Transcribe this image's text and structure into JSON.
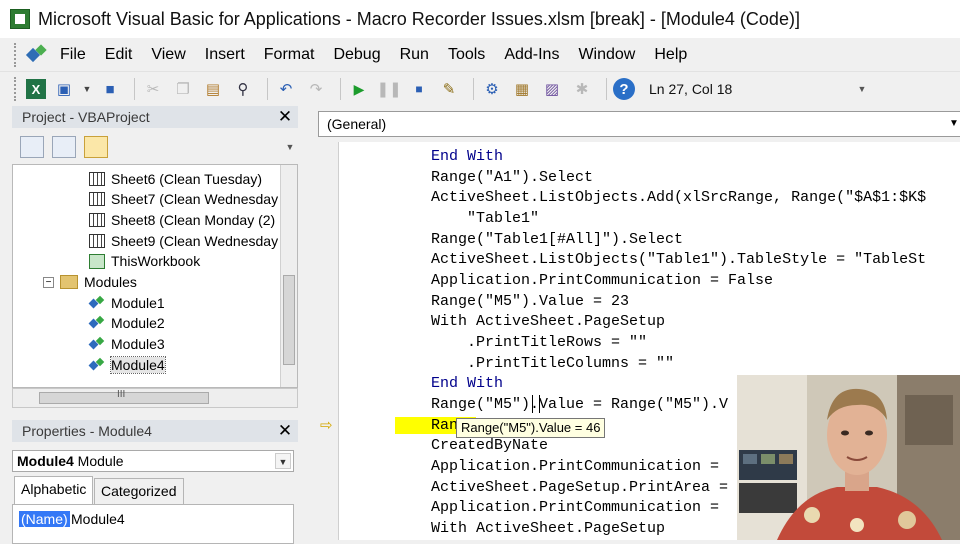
{
  "window": {
    "title": "Microsoft Visual Basic for Applications - Macro Recorder Issues.xlsm [break] - [Module4 (Code)]"
  },
  "menu": [
    "File",
    "Edit",
    "View",
    "Insert",
    "Format",
    "Debug",
    "Run",
    "Tools",
    "Add-Ins",
    "Window",
    "Help"
  ],
  "toolbar": {
    "position": "Ln 27, Col 18"
  },
  "project": {
    "title": "Project - VBAProject",
    "items": [
      {
        "label": "Sheet6 (Clean Tuesday)",
        "icon": "sheet-icon"
      },
      {
        "label": "Sheet7 (Clean Wednesday",
        "icon": "sheet-icon"
      },
      {
        "label": "Sheet8 (Clean Monday (2)",
        "icon": "sheet-icon"
      },
      {
        "label": "Sheet9 (Clean Wednesday",
        "icon": "sheet-icon"
      },
      {
        "label": "ThisWorkbook",
        "icon": "workbook-icon"
      },
      {
        "label": "Modules",
        "icon": "folder-icon"
      },
      {
        "label": "Module1",
        "icon": "module-icon"
      },
      {
        "label": "Module2",
        "icon": "module-icon"
      },
      {
        "label": "Module3",
        "icon": "module-icon"
      },
      {
        "label": "Module4",
        "icon": "module-icon"
      }
    ],
    "expander": "−",
    "hscroll_grip": "III"
  },
  "properties": {
    "title": "Properties - Module4",
    "object_name": "Module4",
    "object_type": "Module",
    "tabs": [
      "Alphabetic",
      "Categorized"
    ],
    "row_name": "(Name)",
    "row_value": "Module4"
  },
  "code": {
    "scope": "(General)",
    "lines": [
      "    End With",
      "    Range(\"A1\").Select",
      "    ActiveSheet.ListObjects.Add(xlSrcRange, Range(\"$A$1:$K$",
      "        \"Table1\"",
      "    Range(\"Table1[#All]\").Select",
      "    ActiveSheet.ListObjects(\"Table1\").TableStyle = \"TableSt",
      "    Application.PrintCommunication = False",
      "    Range(\"M5\").Value = 23",
      "    With ActiveSheet.PageSetup",
      "        .PrintTitleRows = \"\"",
      "        .PrintTitleColumns = \"\"",
      "    End With",
      "    Range(\"M5\").Value = Range(\"M5\").V",
      "    Range",
      "    CreatedByNate",
      "    Application.PrintCommunication =",
      "    ActiveSheet.PageSetup.PrintArea =",
      "    Application.PrintCommunication =",
      "    With ActiveSheet.PageSetup"
    ],
    "tooltip": "Range(\"M5\").Value = 46"
  },
  "colors": {
    "keyword": "#00008b",
    "exec_highlight": "#ffff00",
    "tooltip_bg": "#ffffe1"
  }
}
